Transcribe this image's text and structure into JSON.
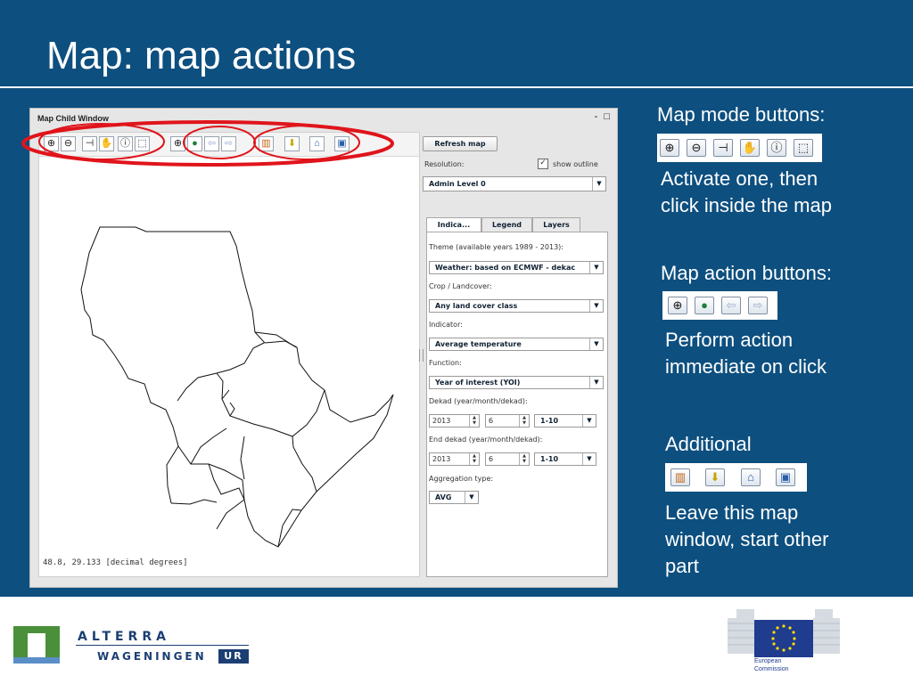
{
  "slide": {
    "title": "Map: map actions"
  },
  "window": {
    "title": "Map Child Window",
    "controls": "- □",
    "status": "48.8, 29.133 [decimal degrees]",
    "toolbar_icons": [
      "zoom-in-icon",
      "zoom-out-icon",
      "select-arrow-icon",
      "pan-hand-icon",
      "info-icon",
      "select-region-icon",
      "zoom-extent-icon",
      "globe-icon",
      "back-arrow-icon",
      "forward-arrow-icon",
      "chart-icon",
      "download-icon",
      "home-icon",
      "save-icon"
    ],
    "sidebar": {
      "refresh_label": "Refresh map",
      "resolution_label": "Resolution:",
      "show_outline_label": "show outline",
      "show_outline_checked": true,
      "resolution_value": "Admin Level 0",
      "tabs": [
        "Indica...",
        "Legend",
        "Layers"
      ],
      "active_tab": "Indica...",
      "theme_label": "Theme (available years 1989 - 2013):",
      "theme_value": "Weather: based on ECMWF - dekac",
      "crop_label": "Crop / Landcover:",
      "crop_value": "Any land cover class",
      "indicator_label": "Indicator:",
      "indicator_value": "Average temperature",
      "function_label": "Function:",
      "function_value": "Year of interest (YOI)",
      "dekad_label": "Dekad (year/month/dekad):",
      "dekad_year": "2013",
      "dekad_month": "6",
      "dekad_value": "1-10",
      "end_dekad_label": "End dekad (year/month/dekad):",
      "end_year": "2013",
      "end_month": "6",
      "end_value": "1-10",
      "aggregation_label": "Aggregation type:",
      "aggregation_value": "AVG"
    }
  },
  "annotations": {
    "mode_title": "Map mode buttons:",
    "mode_text_1": "Activate one, then",
    "mode_text_2": "click inside the map",
    "action_title": "Map action buttons:",
    "action_text_1": "Perform action",
    "action_text_2": "immediate on click",
    "additional_title": "Additional",
    "additional_text_1": "Leave this map",
    "additional_text_2": "window, start other",
    "additional_text_3": "part"
  },
  "footer": {
    "alterra_name": "ALTERRA",
    "wageningen_name": "WAGENINGEN",
    "ur_label": "UR",
    "ec_label_1": "European",
    "ec_label_2": "Commission"
  },
  "colors": {
    "slide_bg": "#0d4f7f",
    "highlight_ellipse": "#e0141b",
    "ec_blue": "#1f3c8f",
    "alterra_green": "#4a8f3a",
    "wur_blue": "#1b3f73"
  }
}
